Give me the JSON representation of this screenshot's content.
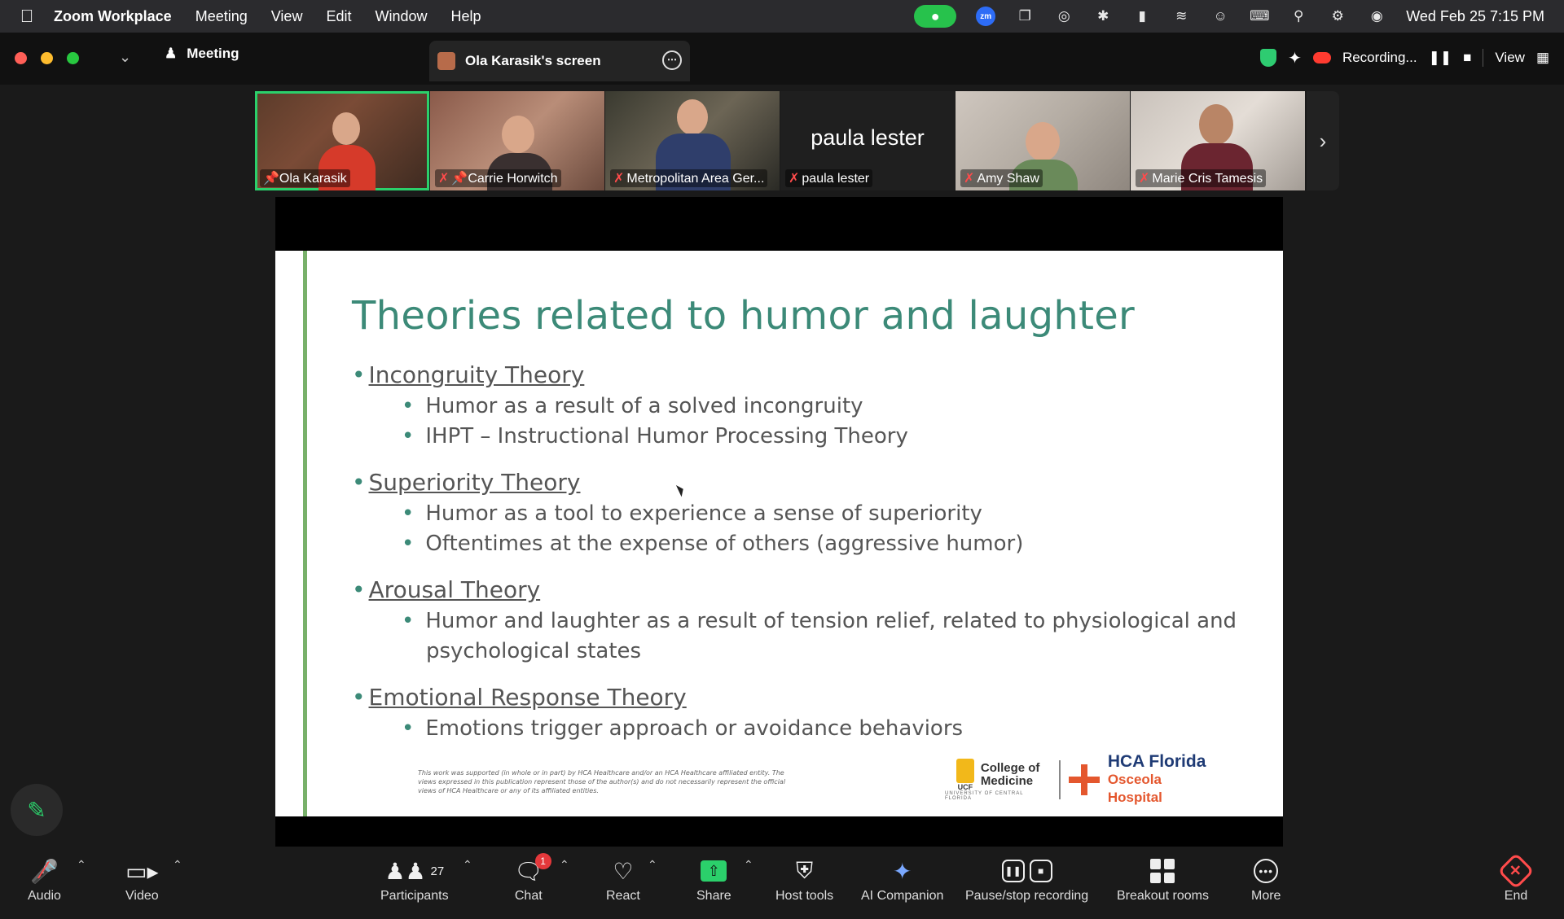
{
  "menubar": {
    "app_name": "Zoom Workplace",
    "items": [
      "Meeting",
      "View",
      "Edit",
      "Window",
      "Help"
    ],
    "zm_badge": "zm",
    "clock": "Wed Feb 25  7:15 PM"
  },
  "titlebar": {
    "meeting_tab": "Meeting",
    "screen_tab": "Ola Karasik's screen",
    "recording_label": "Recording...",
    "view_label": "View"
  },
  "participants_strip": [
    {
      "name": "Ola Karasik",
      "muted": false,
      "pinned": true
    },
    {
      "name": "Carrie Horwitch",
      "muted": true,
      "pinned": true
    },
    {
      "name": "Metropolitan Area Ger...",
      "muted": true
    },
    {
      "name": "paula lester",
      "muted": true,
      "video_off_label": "paula lester"
    },
    {
      "name": "Amy Shaw",
      "muted": true
    },
    {
      "name": "Marie Cris Tamesis",
      "muted": true
    }
  ],
  "slide": {
    "title": "Theories related to humor and laughter",
    "theories": [
      {
        "name": "Incongruity Theory",
        "points": [
          "Humor as a result of a solved incongruity",
          "IHPT – Instructional Humor Processing Theory"
        ]
      },
      {
        "name": "Superiority Theory",
        "points": [
          "Humor as a tool to experience a sense of superiority",
          "Oftentimes at the expense of others (aggressive humor)"
        ]
      },
      {
        "name": "Arousal Theory",
        "points": [
          "Humor and laughter as a result of tension relief, related to physiological and",
          "psychological states"
        ]
      },
      {
        "name": "Emotional Response Theory",
        "points": [
          "Emotions trigger approach or avoidance behaviors"
        ]
      }
    ],
    "disclaimer": "This work was supported (in whole or in part) by HCA Healthcare and/or an HCA Healthcare affiliated entity. The views expressed in this publication represent those of the author(s) and do not necessarily represent the official views of HCA Healthcare or any of its affiliated entities.",
    "logo_ucf_1": "College of",
    "logo_ucf_2": "Medicine",
    "logo_ucf_small": "UCF",
    "logo_ucf_sub": "UNIVERSITY OF CENTRAL FLORIDA",
    "logo_hca_1": "HCA Florida",
    "logo_hca_2": "Osceola Hospital"
  },
  "toolbar": {
    "audio": "Audio",
    "video": "Video",
    "participants": "Participants",
    "participants_count": "27",
    "chat": "Chat",
    "chat_badge": "1",
    "react": "React",
    "share": "Share",
    "host_tools": "Host tools",
    "ai_companion": "AI Companion",
    "pause_stop": "Pause/stop recording",
    "breakout": "Breakout rooms",
    "more": "More",
    "end": "End"
  },
  "colors": {
    "accent_green": "#2bd06b",
    "slide_title": "#3c8a78",
    "end_red": "#ff4b4b",
    "hca_orange": "#e4572e"
  }
}
